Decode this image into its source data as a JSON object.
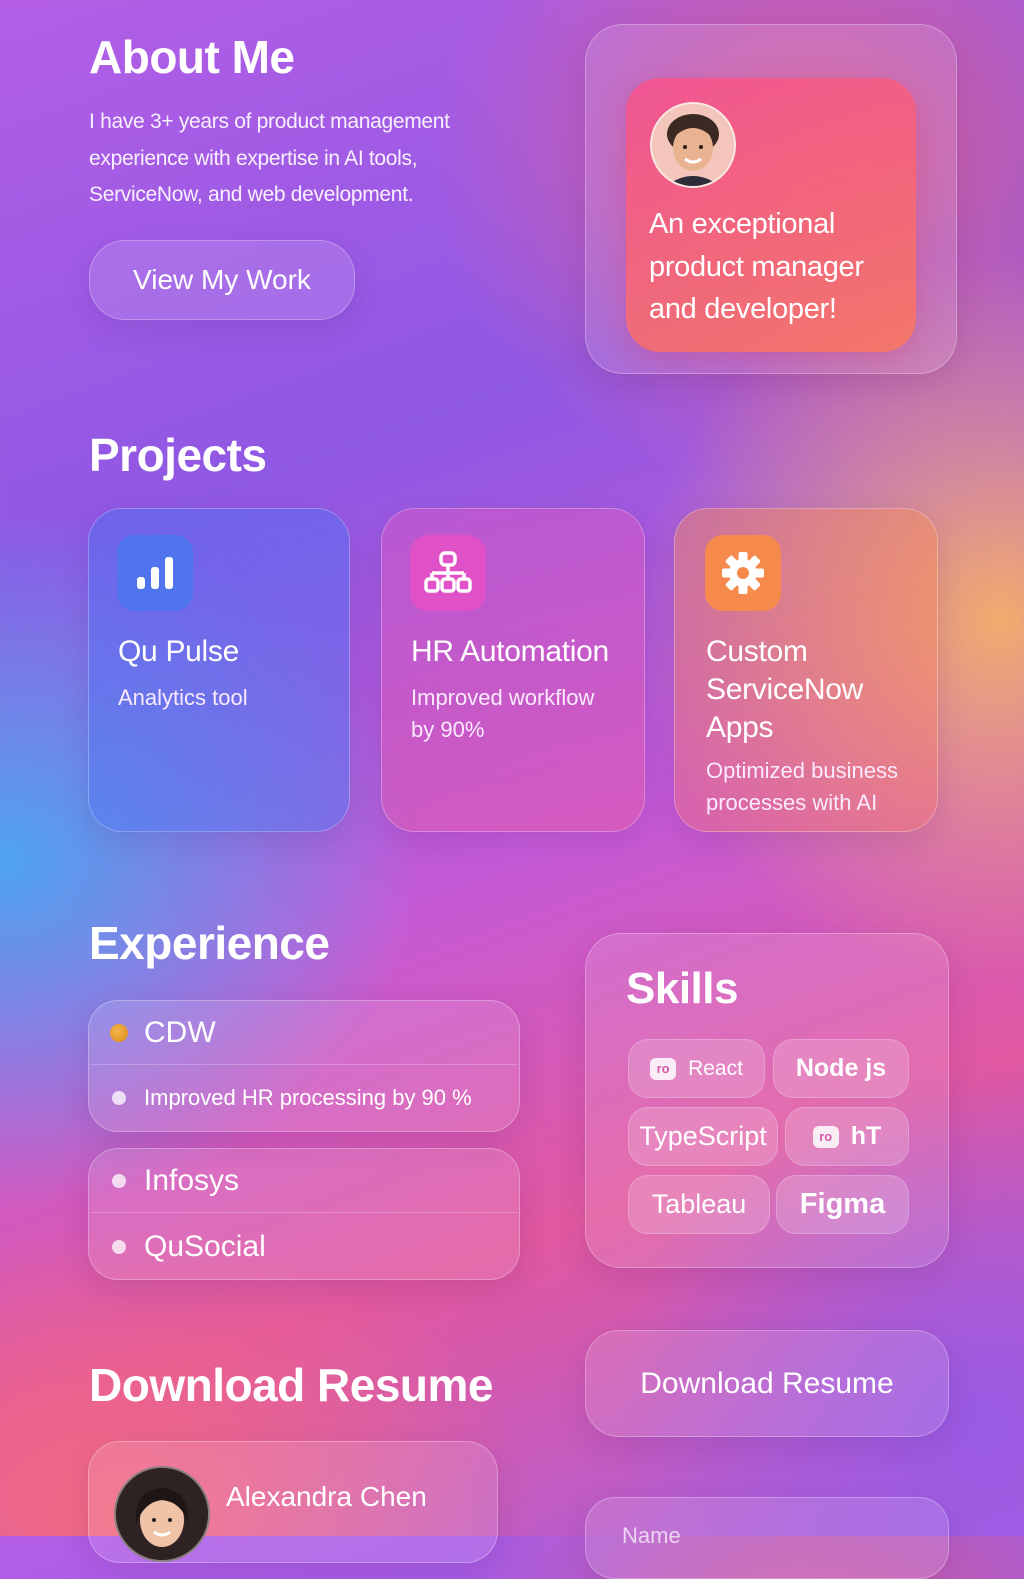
{
  "about": {
    "title": "About Me",
    "text": "I have 3+ years of product management experience with expertise in AI tools, ServiceNow, and web development.",
    "button_label": "View My Work",
    "quote": "An exceptional product manager and developer!"
  },
  "projects": {
    "title": "Projects",
    "items": [
      {
        "title": "Qu Pulse",
        "desc": "Analytics tool",
        "icon": "bar-chart-icon",
        "color": "#4f74ee"
      },
      {
        "title": "HR Automation",
        "desc": "Improved workflow by 90%",
        "icon": "org-chart-icon",
        "color": "#e051c8"
      },
      {
        "title": "Custom ServiceNow Apps",
        "desc": "Optimized business processes with AI",
        "icon": "gear-icon",
        "color": "#f58a4c"
      }
    ]
  },
  "experience": {
    "title": "Experience",
    "items": [
      {
        "label": "CDW",
        "detail": "Improved HR processing by 90 %"
      },
      {
        "label": "Infosys"
      },
      {
        "label": "QuSocial"
      }
    ]
  },
  "skills": {
    "title": "Skills",
    "chips": [
      {
        "label": "React",
        "badge": "ro"
      },
      {
        "label": "Node js"
      },
      {
        "label": "TypeScript"
      },
      {
        "label": "hT",
        "badge": "ro"
      },
      {
        "label": "Tableau"
      },
      {
        "label": "Figma"
      }
    ]
  },
  "download": {
    "title": "Download Resume",
    "button_label": "Download Resume",
    "profile_name": "Alexandra Chen",
    "form_placeholder": "Name"
  },
  "colors": {
    "accent_orange": "#f0a038"
  }
}
